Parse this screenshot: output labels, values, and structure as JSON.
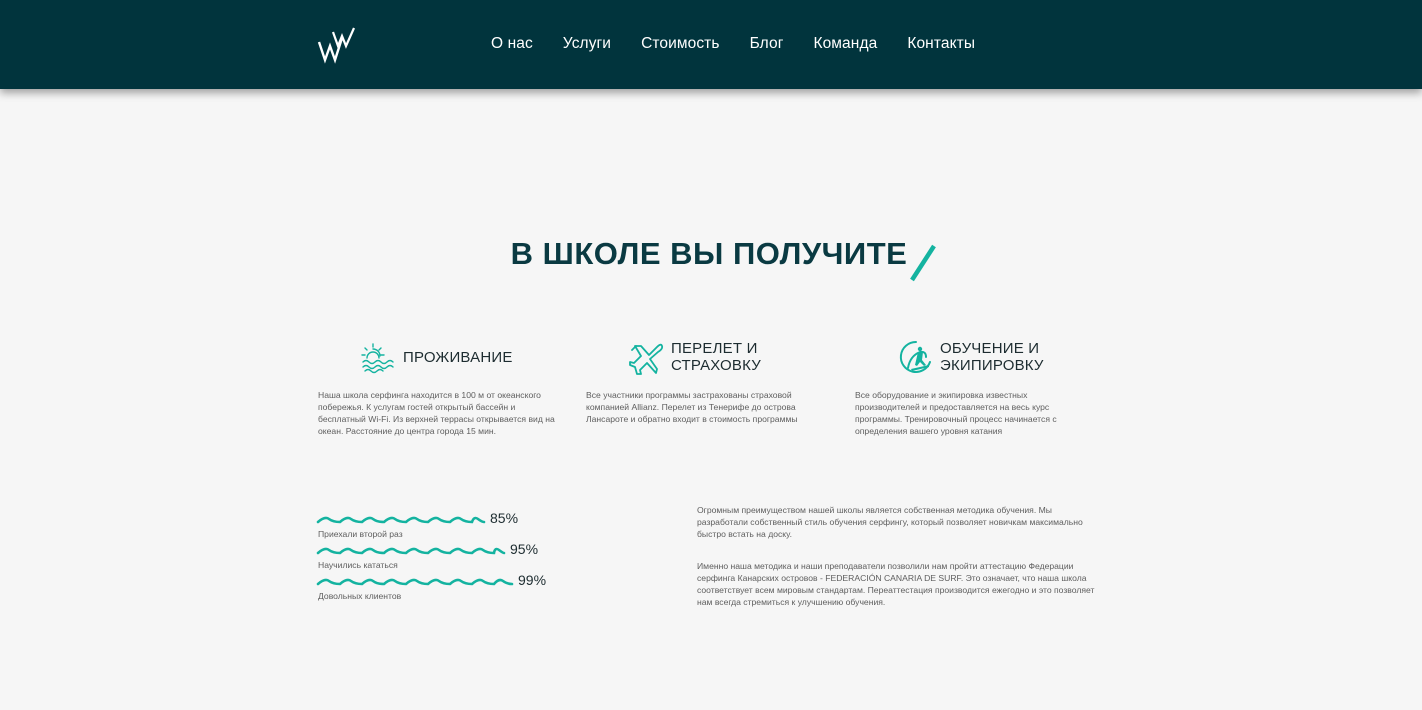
{
  "header": {
    "logo": "logo-ww",
    "nav": [
      "О нас",
      "Услуги",
      "Стоимость",
      "Блог",
      "Команда",
      "Контакты"
    ]
  },
  "section": {
    "title": "В ШКОЛЕ ВЫ ПОЛУЧИТЕ"
  },
  "features": [
    {
      "icon": "sun-waves-icon",
      "title_line1": "ПРОЖИВАНИЕ",
      "title_line2": "",
      "description": "Наша школа серфинга находится в 100 м от океанского побережья. К услугам гостей открытый бассейн и бесплатный Wi-Fi. Из верхней террасы открывается вид на океан. Расстояние до центра города 15 мин."
    },
    {
      "icon": "airplane-icon",
      "title_line1": "ПЕРЕЛЕТ И",
      "title_line2": "СТРАХОВКУ",
      "description": "Все участники программы застрахованы страховой компанией Allianz. Перелет из Тенерифе до острова Лансароте и обратно входит в стоимость программы"
    },
    {
      "icon": "surfer-wave-icon",
      "title_line1": "ОБУЧЕНИЕ И",
      "title_line2": "ЭКИПИРОВКУ",
      "description": "Все оборудование и экипировка известных производителей и предоставляется на весь курс программы. Тренировочный процесс начинается с определения вашего уровня катания"
    }
  ],
  "stats": [
    {
      "value": 85,
      "label_pct": "85%",
      "label": "Приехали второй раз"
    },
    {
      "value": 95,
      "label_pct": "95%",
      "label": "Научились кататься"
    },
    {
      "value": 99,
      "label_pct": "99%",
      "label": "Довольных клиентов"
    }
  ],
  "about": {
    "p1": "Огромным преимуществом нашей школы является собственная методика обучения. Мы разработали собственный стиль обучения серфингу, который позволяет новичкам максимально быстро встать на доску.",
    "p2": "Именно наша методика и наши преподаватели позволили нам пройти аттестацию Федерации серфинга Канарских островов - FEDERACIÓN CANARIA DE SURF. Это означает, что наша школа соответствует всем мировым стандартам. Переаттестация производится ежегодно и это позволяет нам всегда стремиться к улучшению обучения."
  },
  "colors": {
    "header_bg": "#01343d",
    "accent": "#14b3a0",
    "title": "#0a3a42",
    "background": "#f6f6f6"
  }
}
